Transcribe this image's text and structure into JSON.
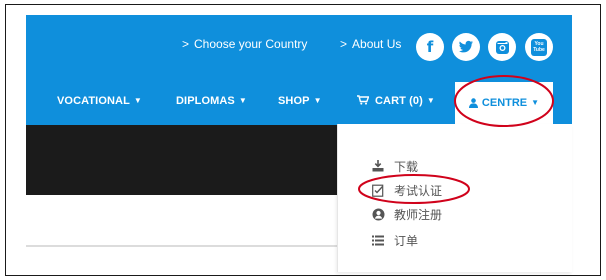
{
  "topbar": {
    "country_link": "Choose your Country",
    "about_link": "About Us",
    "link_chevron": ">"
  },
  "social": [
    {
      "icon": "facebook-icon",
      "glyph": "f"
    },
    {
      "icon": "twitter-icon"
    },
    {
      "icon": "instagram-icon"
    },
    {
      "icon": "youtube-icon",
      "glyph": "You Tube"
    }
  ],
  "nav": {
    "vocational": "VOCATIONAL",
    "diplomas": "DIPLOMAS",
    "shop": "SHOP",
    "cart": "CART (0)",
    "centre": "CENTRE",
    "caret": "▼"
  },
  "dropdown": {
    "items": [
      {
        "label": "下载",
        "icon": "download-icon"
      },
      {
        "label": "考试认证",
        "icon": "checklist-icon"
      },
      {
        "label": "教师注册",
        "icon": "user-circle-icon"
      },
      {
        "label": "订单",
        "icon": "list-icon"
      }
    ]
  },
  "colors": {
    "brand_blue": "#0f8fdc",
    "dark_band": "#1b1b1b",
    "annotation_red": "#d0021b"
  }
}
